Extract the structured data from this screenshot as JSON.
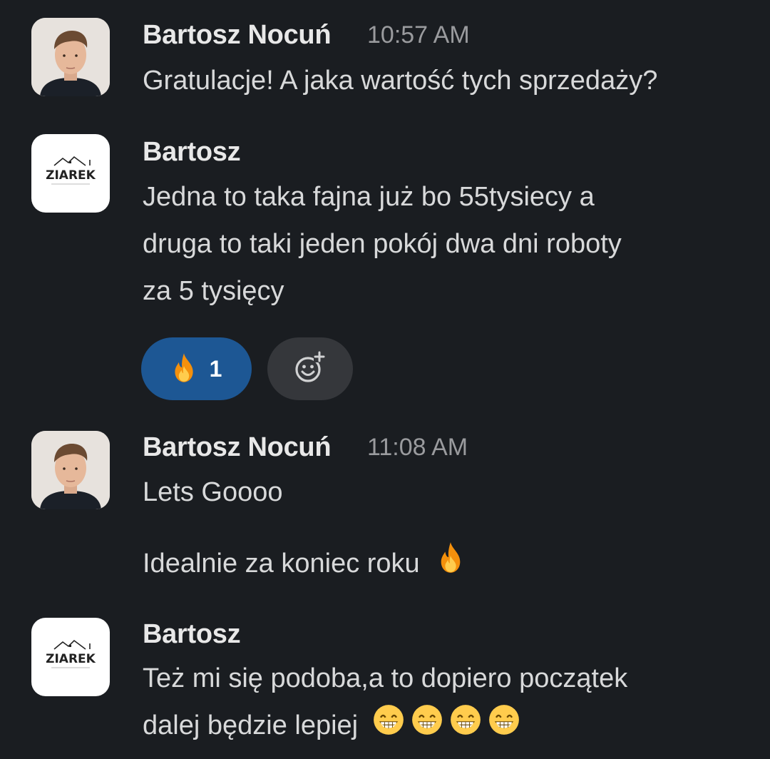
{
  "messages": [
    {
      "author": "Bartosz Nocuń",
      "time": "10:57 AM",
      "lines": [
        "Gratulacje! A jaka wartość tych sprzedaży?"
      ]
    },
    {
      "author": "Bartosz",
      "logo_text": "ZIAREK",
      "lines": [
        "Jedna to taka fajna już bo 55tysiecy a",
        "druga to taki jeden pokój dwa dni roboty",
        "za 5 tysięcy"
      ],
      "reaction": {
        "emoji": "fire-icon",
        "count": "1"
      }
    },
    {
      "author": "Bartosz Nocuń",
      "time": "11:08 AM",
      "lines": [
        "Lets Goooo",
        "Idealnie za koniec roku"
      ]
    },
    {
      "author": "Bartosz",
      "logo_text": "ZIAREK",
      "lines": [
        "Też mi się podoba,a to dopiero początek",
        "dalej będzie lepiej"
      ]
    }
  ],
  "colors": {
    "background": "#1a1d21",
    "reaction_active": "#1d5794",
    "reaction_add": "#35373b"
  }
}
